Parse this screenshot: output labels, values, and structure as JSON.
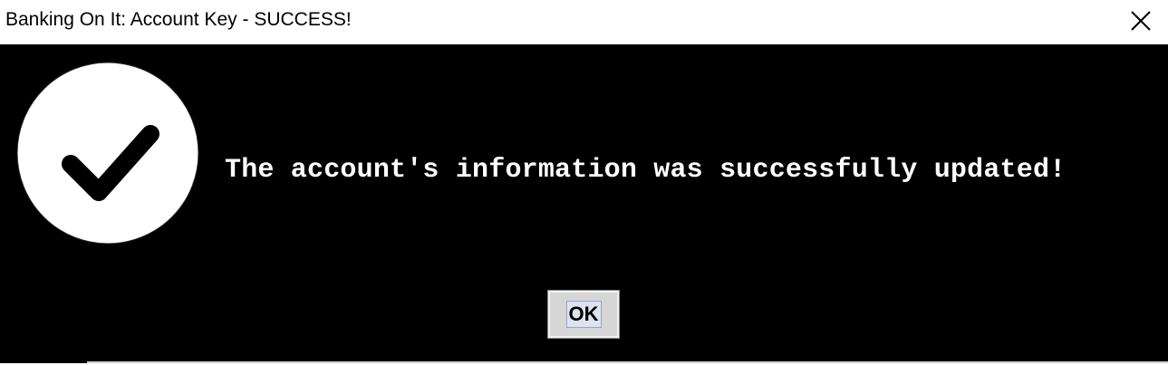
{
  "window": {
    "title": "Banking On It: Account Key - SUCCESS!"
  },
  "dialog": {
    "icon": "success-check-icon",
    "message": "The account's information was successfully updated!",
    "ok_label": "OK"
  },
  "colors": {
    "background": "#000000",
    "titlebar": "#ffffff",
    "message_text": "#ffffff",
    "button_face": "#d6d6d6"
  }
}
